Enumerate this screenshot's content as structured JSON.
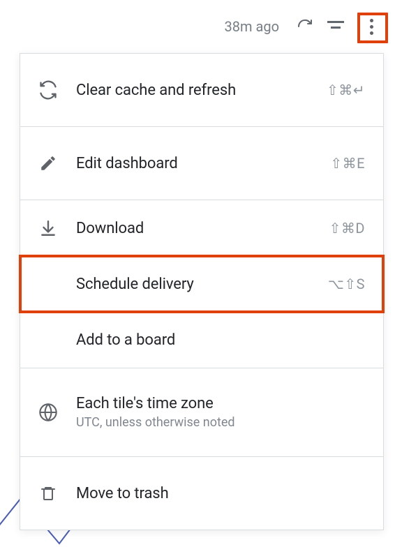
{
  "toolbar": {
    "timestamp": "38m ago"
  },
  "menu": {
    "clear_cache": "Clear cache and refresh",
    "clear_cache_shortcut": "⇧⌘↵",
    "edit_dashboard": "Edit dashboard",
    "edit_dashboard_shortcut": "⇧⌘E",
    "download": "Download",
    "download_shortcut": "⇧⌘D",
    "schedule_delivery": "Schedule delivery",
    "schedule_delivery_shortcut": "⌥⇧S",
    "add_to_board": "Add to a board",
    "timezone_title": "Each tile's time zone",
    "timezone_subtitle": "UTC, unless otherwise noted",
    "move_to_trash": "Move to trash"
  }
}
